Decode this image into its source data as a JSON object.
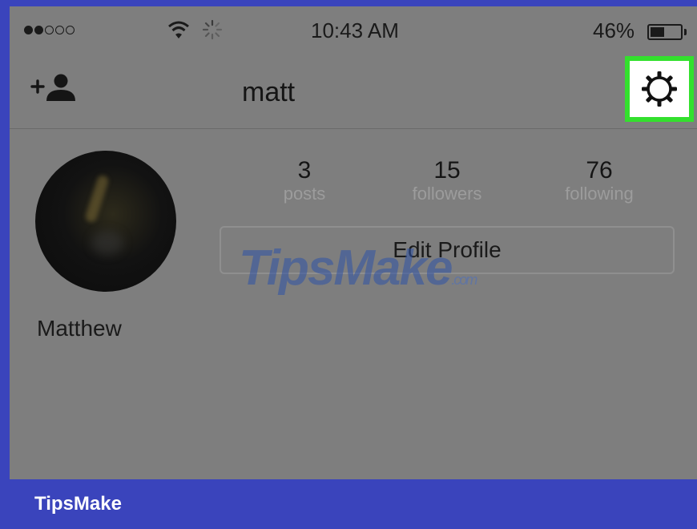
{
  "status_bar": {
    "signal_bars": 2,
    "signal_total": 5,
    "time": "10:43 AM",
    "battery_percent": "46%",
    "battery_level": 0.46,
    "icons": [
      "signal-dots-icon",
      "wifi-icon",
      "activity-spinner-icon",
      "battery-icon"
    ]
  },
  "nav": {
    "add_user_icon": "add-person-icon",
    "username": "matt",
    "settings_icon": "gear-icon",
    "highlight_color": "#33e02d"
  },
  "profile": {
    "display_name": "Matthew",
    "stats": [
      {
        "value": "3",
        "label": "posts"
      },
      {
        "value": "15",
        "label": "followers"
      },
      {
        "value": "76",
        "label": "following"
      }
    ],
    "edit_button_label": "Edit Profile"
  },
  "watermark": {
    "brand": "TipsMake",
    "suffix": ".com"
  },
  "footer": {
    "brand": "TipsMake"
  },
  "colors": {
    "frame": "#3a44bc",
    "screen_dim": "#7e7e7e"
  }
}
